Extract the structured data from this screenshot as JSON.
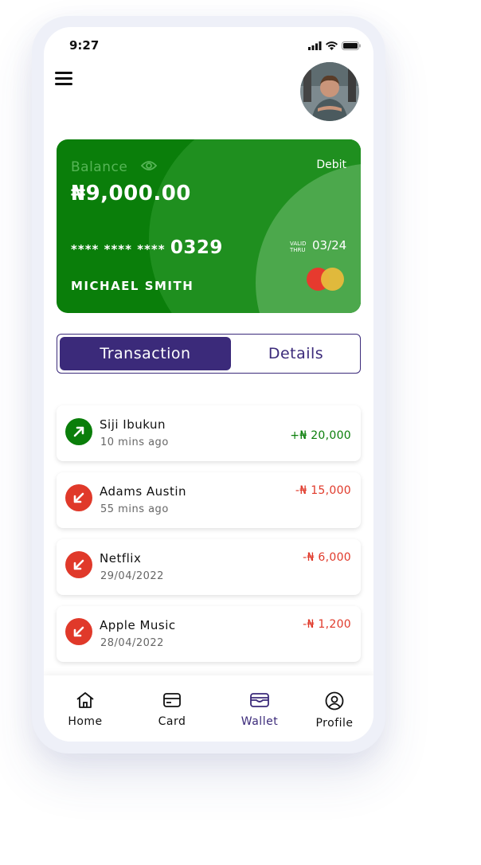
{
  "status": {
    "time": "9:27"
  },
  "card": {
    "balance_label": "Balance",
    "balance": "₦9,000.00",
    "type": "Debit",
    "number_masked": "**** **** ****",
    "number_last4": "0329",
    "valid_thru": "VALID THRU",
    "expiry": "03/24",
    "holder": "MICHAEL SMITH"
  },
  "tabs": [
    {
      "label": "Transaction",
      "active": true
    },
    {
      "label": "Details",
      "active": false
    }
  ],
  "transactions": [
    {
      "name": "Siji Ibukun",
      "time": "10 mins ago",
      "amount": "+₦ 20,000",
      "direction": "in"
    },
    {
      "name": "Adams Austin",
      "time": "55 mins ago",
      "amount": "-₦ 15,000",
      "direction": "out"
    },
    {
      "name": "Netflix",
      "time": "29/04/2022",
      "amount": "-₦ 6,000",
      "direction": "out"
    },
    {
      "name": "Apple Music",
      "time": "28/04/2022",
      "amount": "-₦ 1,200",
      "direction": "out"
    }
  ],
  "nav": [
    {
      "label": "Home",
      "icon": "home-icon"
    },
    {
      "label": "Card",
      "icon": "card-icon"
    },
    {
      "label": "Wallet",
      "icon": "wallet-icon",
      "active": true
    },
    {
      "label": "Profile",
      "icon": "profile-icon"
    }
  ],
  "colors": {
    "primary": "#3b2a7a",
    "card_green": "#0a7e0a",
    "credit": "#0a7e0a",
    "debit": "#e0392a"
  }
}
